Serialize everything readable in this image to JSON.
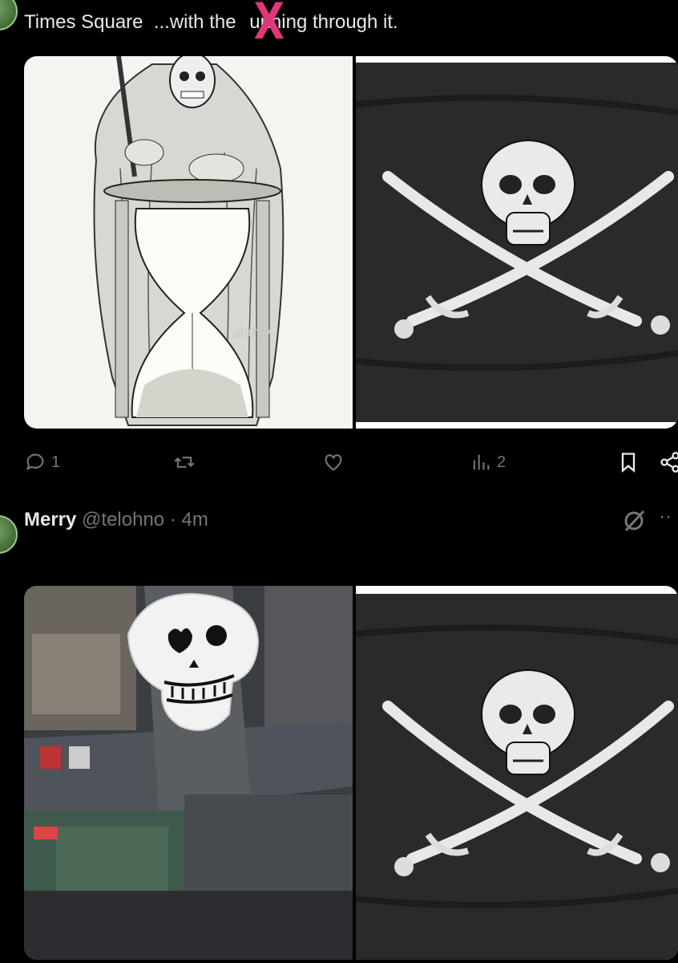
{
  "post1": {
    "text_before": "Times Square  ...with the ",
    "text_after": "unning through it.",
    "overlay_mark": "X",
    "actions": {
      "replies": "1",
      "views": "2"
    }
  },
  "post2": {
    "author_name": "Merry",
    "handle": "@telohno",
    "separator": "·",
    "time": "4m"
  },
  "icons": {
    "reply": "reply-icon",
    "repost": "repost-icon",
    "like": "like-icon",
    "views": "views-icon",
    "bookmark": "bookmark-icon",
    "share": "share-icon",
    "grok": "grok-icon",
    "more": "more-icon"
  },
  "colors": {
    "background": "#000000",
    "text": "#e7e9ea",
    "muted": "#71767b",
    "mark": "#e0367a"
  }
}
